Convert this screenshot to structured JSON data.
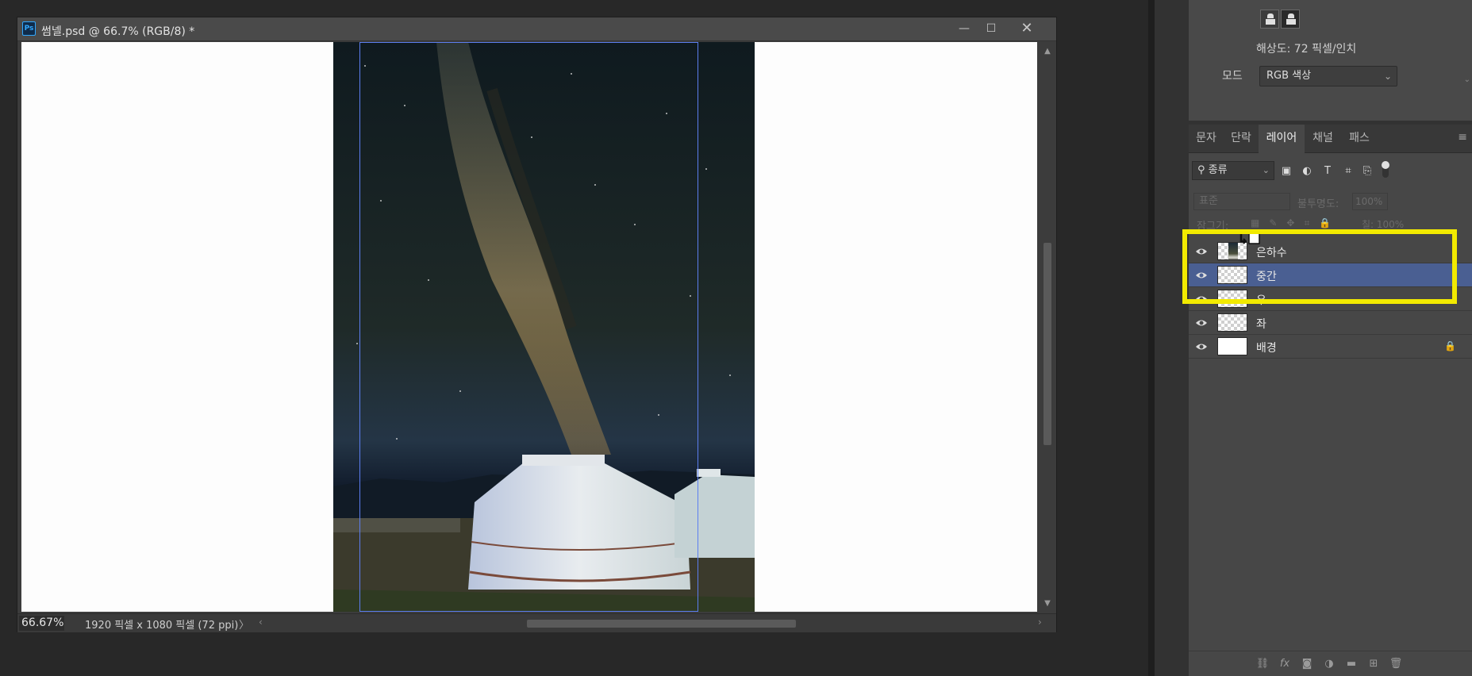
{
  "document": {
    "app_icon": "Ps",
    "title": "썸넬.psd @ 66.7% (RGB/8) *",
    "window_buttons": {
      "minimize": "—",
      "maximize": "☐",
      "close": "✕"
    },
    "status": {
      "zoom": "66.67%",
      "doc_size": "1920 픽셀 x 1080 픽셀 (72 ppi)",
      "more_arrow": "〉"
    }
  },
  "properties": {
    "resolution": "해상도: 72 픽셀/인치",
    "mode_label": "모드",
    "mode_value": "RGB 색상"
  },
  "layers_panel": {
    "tabs": [
      {
        "label": "문자",
        "active": false
      },
      {
        "label": "단락",
        "active": false
      },
      {
        "label": "레이어",
        "active": true
      },
      {
        "label": "채널",
        "active": false
      },
      {
        "label": "패스",
        "active": false
      }
    ],
    "kind_filter": "종류",
    "blend_mode": "표준",
    "opacity_label": "불투명도:",
    "opacity_value": "100%",
    "lock_label": "잠그기:",
    "fill_label": "칠: 100%",
    "layers": [
      {
        "name": "은하수",
        "thumb": "photo",
        "selected": false,
        "locked": false
      },
      {
        "name": "중간",
        "thumb": "smart",
        "selected": true,
        "locked": false
      },
      {
        "name": "우",
        "thumb": "smart",
        "selected": false,
        "locked": false
      },
      {
        "name": "좌",
        "thumb": "smart",
        "selected": false,
        "locked": false
      },
      {
        "name": "배경",
        "thumb": "white",
        "selected": false,
        "locked": true
      }
    ]
  },
  "colors": {
    "selection_row": "#4a5f92",
    "annotation_highlight": "#f2ea00",
    "guide": "#5c7ef0",
    "ps_icon": "#31a8ff"
  }
}
